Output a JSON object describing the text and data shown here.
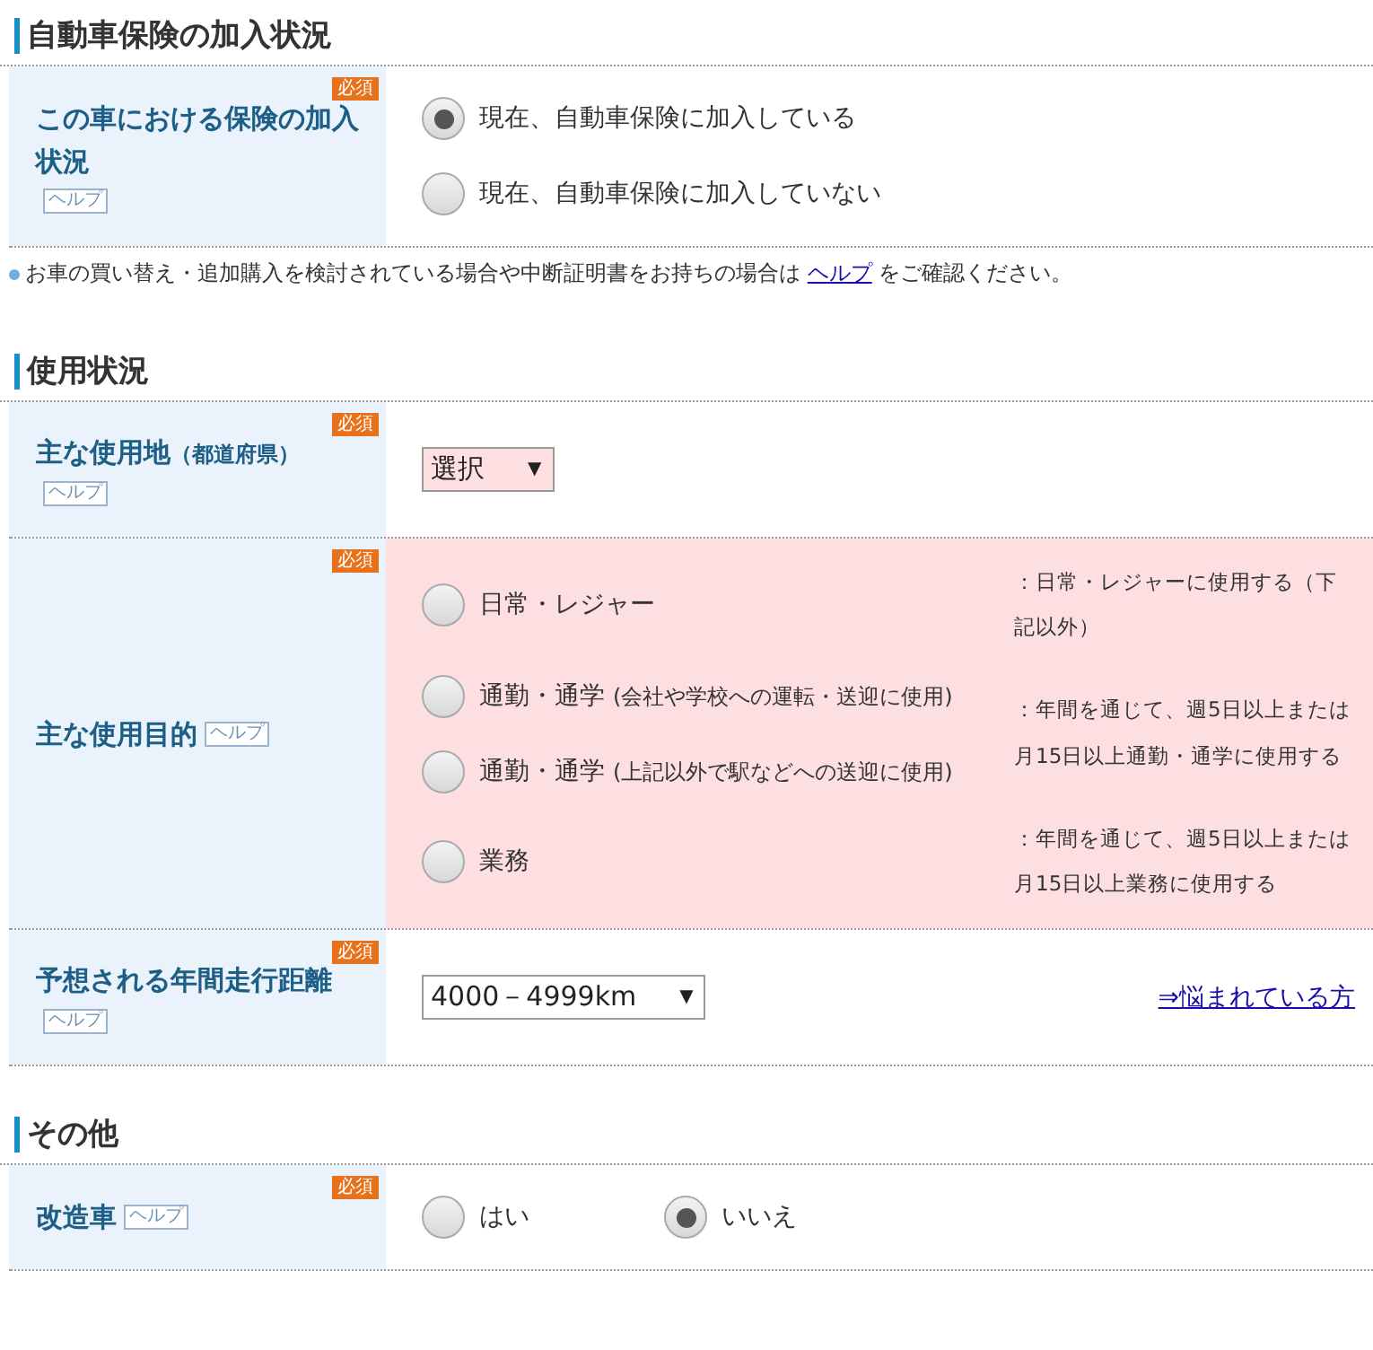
{
  "sections": [
    {
      "title": "自動車保険の加入状況",
      "rows": [
        {
          "kind": "radio",
          "label": "この車における保険の加入状況",
          "required": "必須",
          "help": "ヘルプ",
          "invalid": false,
          "options": [
            {
              "label": "現在、自動車保険に加入している",
              "selected": true
            },
            {
              "label": "現在、自動車保険に加入していない",
              "selected": false
            }
          ]
        }
      ],
      "note": {
        "before": "お車の買い替え・追加購入を検討されている場合や中断証明書をお持ちの場合は ",
        "link": "ヘルプ",
        "after": " をご確認ください。"
      }
    },
    {
      "title": "使用状況",
      "rows": [
        {
          "kind": "select",
          "label": "主な使用地",
          "sublabel": "（都道府県）",
          "required": "必須",
          "help": "ヘルプ",
          "invalid": true,
          "value": "選択",
          "caret": "▼"
        },
        {
          "kind": "purpose",
          "label": "主な使用目的",
          "required": "必須",
          "help": "ヘルプ",
          "invalid": true,
          "groups": [
            {
              "options": [
                {
                  "label": "日常・レジャー",
                  "selected": false
                }
              ],
              "description": "：日常・レジャーに使用する（下記以外）"
            },
            {
              "options": [
                {
                  "label": "通勤・通学",
                  "sub": "(会社や学校への運転・送迎に使用)",
                  "selected": false
                },
                {
                  "label": "通勤・通学",
                  "sub": "(上記以外で駅などへの送迎に使用)",
                  "selected": false
                }
              ],
              "description": "：年間を通じて、週5日以上または月15日以上通勤・通学に使用する"
            },
            {
              "options": [
                {
                  "label": "業務",
                  "selected": false
                }
              ],
              "description": "：年間を通じて、週5日以上または月15日以上業務に使用する"
            }
          ]
        },
        {
          "kind": "select",
          "label": "予想される年間走行距離",
          "required": "必須",
          "help": "ヘルプ",
          "invalid": false,
          "value": "4000－4999km",
          "caret": "▼",
          "link": "⇒悩まれている方"
        }
      ]
    },
    {
      "title": "その他",
      "rows": [
        {
          "kind": "yesno",
          "label": "改造車",
          "required": "必須",
          "help": "ヘルプ",
          "invalid": false,
          "options": [
            {
              "label": "はい",
              "selected": false
            },
            {
              "label": "いいえ",
              "selected": true
            }
          ]
        }
      ]
    }
  ]
}
